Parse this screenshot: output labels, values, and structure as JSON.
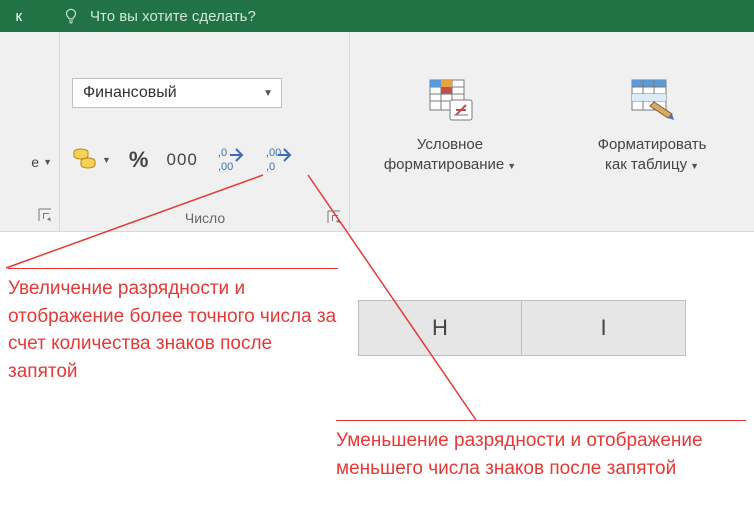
{
  "titlebar": {
    "tab_fragment": "к",
    "tellme_placeholder": "Что вы хотите сделать?"
  },
  "left_group": {
    "partial_label": "е"
  },
  "number_group": {
    "format_selected": "Финансовый",
    "sep_label": "000",
    "group_label": "Число"
  },
  "cond_format": {
    "line1": "Условное",
    "line2": "форматирование"
  },
  "format_table": {
    "line1": "Форматировать",
    "line2": "как таблицу"
  },
  "columns": {
    "h": "H",
    "i": "I"
  },
  "annotations": {
    "increase": "Увеличение разрядности и отображение более точного числа за счет количества знаков после запятой",
    "decrease": "Уменьшение разрядности и отображение меньшего числа знаков после запятой"
  }
}
